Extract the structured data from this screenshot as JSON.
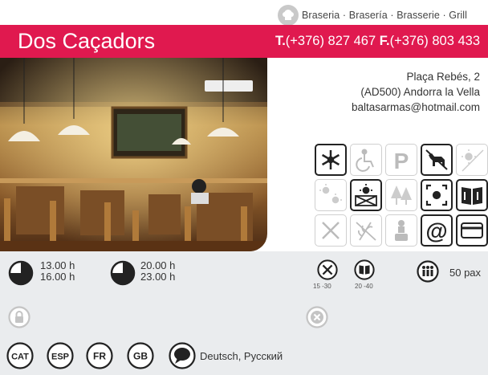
{
  "header": {
    "category": "Braseria · Brasería · Brasserie · Grill",
    "name": "Dos Caçadors",
    "tel_label": "T.",
    "tel": "(+376) 827 467",
    "fax_label": "F.",
    "fax": "(+376) 803 433"
  },
  "address": {
    "street": "Plaça Rebés, 2",
    "city": "(AD500) Andorra la Vella",
    "email": "baltasarmas@hotmail.com"
  },
  "facilities": [
    {
      "icon": "snowflake-icon",
      "active": true
    },
    {
      "icon": "wheelchair-icon",
      "active": false
    },
    {
      "icon": "parking-icon",
      "active": false
    },
    {
      "icon": "dog-icon",
      "active": true
    },
    {
      "icon": "no-sun-icon",
      "active": false
    },
    {
      "icon": "sun-icon",
      "active": false
    },
    {
      "icon": "terrace-icon",
      "active": true
    },
    {
      "icon": "trees-icon",
      "active": false
    },
    {
      "icon": "view-icon",
      "active": true
    },
    {
      "icon": "menu-book-icon",
      "active": true
    },
    {
      "icon": "cutlery-icon",
      "active": false
    },
    {
      "icon": "gluten-free-icon",
      "active": false
    },
    {
      "icon": "chef-icon",
      "active": false
    },
    {
      "icon": "at-icon",
      "active": true
    },
    {
      "icon": "credit-card-icon",
      "active": true
    }
  ],
  "hours": {
    "lunch_open": "13.00 h",
    "lunch_close": "16.00 h",
    "dinner_open": "20.00 h",
    "dinner_close": "23.00 h"
  },
  "prices": {
    "menu_a": "15 -30",
    "menu_b": "20 -40"
  },
  "capacity": "50 pax",
  "languages": {
    "codes": [
      "CAT",
      "ESP",
      "FR",
      "GB"
    ],
    "other": "Deutsch, Русский"
  },
  "colors": {
    "brand": "#e0194f",
    "panel": "#eaecee",
    "icon_dark": "#222222"
  }
}
